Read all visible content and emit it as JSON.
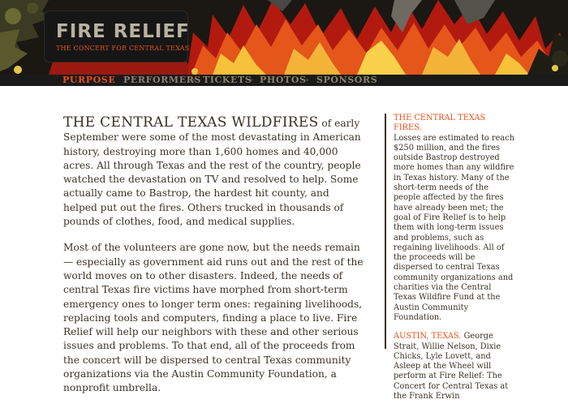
{
  "header": {
    "logo_title": "FIRE RELIEF",
    "logo_subtitle": "THE CONCERT FOR CENTRAL TEXAS"
  },
  "nav": {
    "items": [
      {
        "label": "PURPOSE",
        "active": true
      },
      {
        "label": "PERFORMERS",
        "active": false
      },
      {
        "label": "TICKETS",
        "active": false
      },
      {
        "label": "PHOTOS",
        "active": false
      },
      {
        "label": "SPONSORS",
        "active": false
      }
    ],
    "separator": "»"
  },
  "main": {
    "lead_heading": "THE CENTRAL TEXAS WILDFIRES",
    "paragraph1_rest": " of early September were some of the most devastating in American history, destroying more than 1,600 homes and 40,000 acres. All through Texas and the rest of the country, people watched the devastation on TV and resolved to help. Some actually came to Bastrop, the hardest hit county, and helped put out the fires. Others trucked in thousands of pounds of clothes, food, and medical supplies.",
    "paragraph2": "Most of the volunteers are gone now, but the needs remain — especially as government aid runs out and the rest of the world moves on to other disasters. Indeed, the needs of central Texas fire victims have morphed from short-term emergency ones to longer term ones: regaining livelihoods, replacing tools and computers, finding a place to live. Fire Relief will help our neighbors with these and other serious issues and problems. To that end, all of the proceeds from the concert will be dispersed to central Texas community organizations via the Austin Community Foundation, a nonprofit umbrella."
  },
  "sidebar": {
    "block1_heading": "THE CENTRAL TEXAS FIRES.",
    "block1_text": "Losses are estimated to reach $250 million, and the fires outside Bastrop destroyed more homes than any wildfire in Texas history. Many of the short-term needs of the people affected by the fires have already been met; the goal of Fire Relief is to help them with long-term issues and problems, such as regaining livelihoods. All of the proceeds will be dispersed to central Texas community organizations and charities via the Central Texas Wildfire Fund at the Austin Community Foundation.",
    "block2_heading": "AUSTIN, TEXAS.",
    "block2_text": " George Strait, Willie Nelson, Dixie Chicks, Lyle Lovett, and Asleep at the Wheel will perform at Fire Relief: The Concert for Central Texas at the Frank Erwin"
  },
  "colors": {
    "accent": "#e8501c",
    "text": "#3a3226",
    "nav_text": "#8a8474",
    "nav_bg": "#1a1a1a",
    "banner_bg": "#141414"
  },
  "icons": {
    "banner_art": "stylized-flames-illustration"
  }
}
